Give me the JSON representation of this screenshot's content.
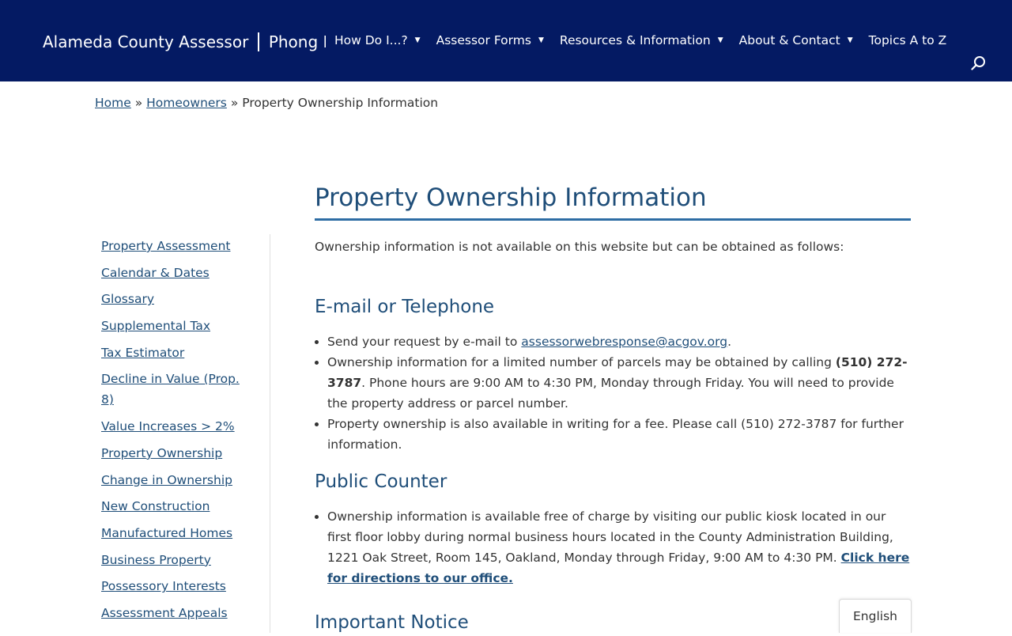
{
  "header": {
    "logo_left": "Alameda County Assessor",
    "logo_right": "Phong La",
    "nav": [
      {
        "label": "How Do I...?"
      },
      {
        "label": "Assessor Forms"
      },
      {
        "label": "Resources & Information"
      },
      {
        "label": "About & Contact"
      },
      {
        "label": "Topics A to Z"
      }
    ],
    "search_icon": "search-icon"
  },
  "breadcrumb": {
    "home": "Home",
    "sep": "»",
    "homeowners": "Homeowners",
    "current": "Property Ownership Information"
  },
  "sidebar": {
    "items": [
      {
        "label": "Property Assessment"
      },
      {
        "label": "Calendar & Dates"
      },
      {
        "label": "Glossary"
      },
      {
        "label": "Supplemental Tax"
      },
      {
        "label": "Tax Estimator"
      },
      {
        "label": "Decline in Value (Prop. 8)"
      },
      {
        "label": "Value Increases > 2%"
      },
      {
        "label": "Property Ownership"
      },
      {
        "label": "Change in Ownership"
      },
      {
        "label": "New Construction"
      },
      {
        "label": "Manufactured Homes"
      },
      {
        "label": "Business Property"
      },
      {
        "label": "Possessory Interests"
      },
      {
        "label": "Assessment Appeals"
      }
    ]
  },
  "main": {
    "title": "Property Ownership Information",
    "intro": "Ownership information is not available on this website but can be obtained as follows:",
    "email_section": {
      "heading": "E-mail or Telephone",
      "b1_text": "Send your request by e-mail to ",
      "b1_email": "assessorwebresponse@acgov.org",
      "b1_end": ".",
      "b2_text": "Ownership information for a limited number of parcels may be obtained by calling ",
      "b2_phone": "(510) 272-3787",
      "b2_rest": ". Phone hours are 9:00 AM to 4:30 PM, Monday through Friday. You will need to provide the property address or parcel number.",
      "b3_text": "Property ownership is also available in writing for a fee. Please call (510) 272-3787 for further information."
    },
    "counter_section": {
      "heading": "Public Counter",
      "b1_text": "Ownership information is available free of charge by visiting our public kiosk located in our first floor lobby during normal business hours located in the County Administration Building, 1221 Oak Street, Room 145, Oakland, Monday through Friday, 9:00 AM to 4:30 PM. ",
      "b1_link": "Click here for directions to our office."
    },
    "notice_heading": "Important Notice"
  },
  "language": {
    "label": "English"
  },
  "colors": {
    "header_bg": "#041a63",
    "link": "#1f4e79",
    "heading": "#1f4e79"
  }
}
